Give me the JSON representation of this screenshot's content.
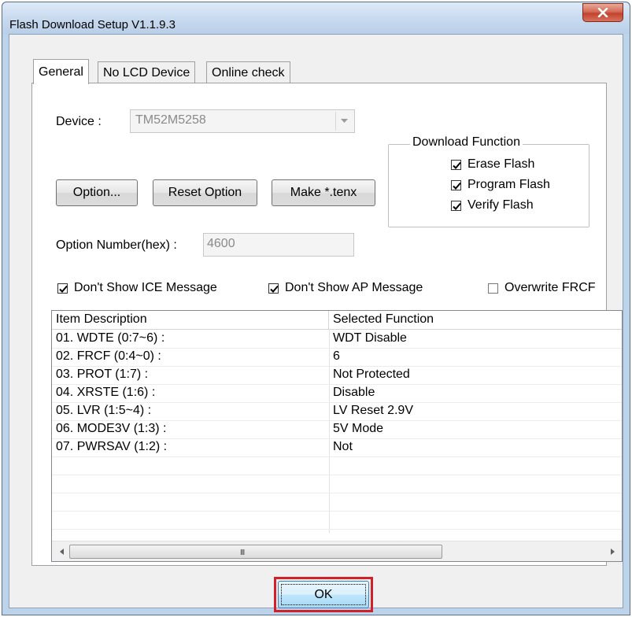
{
  "window": {
    "title": "Flash Download Setup V1.1.9.3",
    "close_icon": "close-icon"
  },
  "tabs": [
    {
      "label": "General",
      "active": true
    },
    {
      "label": "No LCD Device",
      "active": false
    },
    {
      "label": "Online check",
      "active": false
    }
  ],
  "general": {
    "device_label": "Device :",
    "device_value": "TM52M5258",
    "buttons": {
      "option": "Option...",
      "reset_option": "Reset Option",
      "make_tenx": "Make *.tenx"
    },
    "option_number_label": "Option Number(hex) :",
    "option_number_value": "4600",
    "download_function": {
      "title": "Download Function",
      "erase_flash": {
        "label": "Erase Flash",
        "checked": true
      },
      "program_flash": {
        "label": "Program Flash",
        "checked": true
      },
      "verify_flash": {
        "label": "Verify Flash",
        "checked": true
      }
    },
    "dont_show_ice": {
      "label": "Don't Show ICE Message",
      "checked": true
    },
    "dont_show_ap": {
      "label": "Don't Show AP Message",
      "checked": true
    },
    "overwrite_frcf": {
      "label": "Overwrite FRCF",
      "checked": false
    }
  },
  "options_table": {
    "columns": [
      "Item Description",
      "Selected Function"
    ],
    "rows": [
      [
        "01. WDTE (0:7~6) :",
        "WDT Disable"
      ],
      [
        "02. FRCF (0:4~0) :",
        "6"
      ],
      [
        "03. PROT (1:7) :",
        "Not Protected"
      ],
      [
        "04. XRSTE (1:6) :",
        "Disable"
      ],
      [
        "05. LVR (1:5~4) :",
        "LV Reset 2.9V"
      ],
      [
        "06. MODE3V (1:3) :",
        "5V Mode"
      ],
      [
        "07. PWRSAV (1:2) :",
        "Not"
      ]
    ],
    "scrollbar_grip": "III"
  },
  "footer": {
    "ok_label": "OK",
    "highlight_color": "#d0202a"
  }
}
